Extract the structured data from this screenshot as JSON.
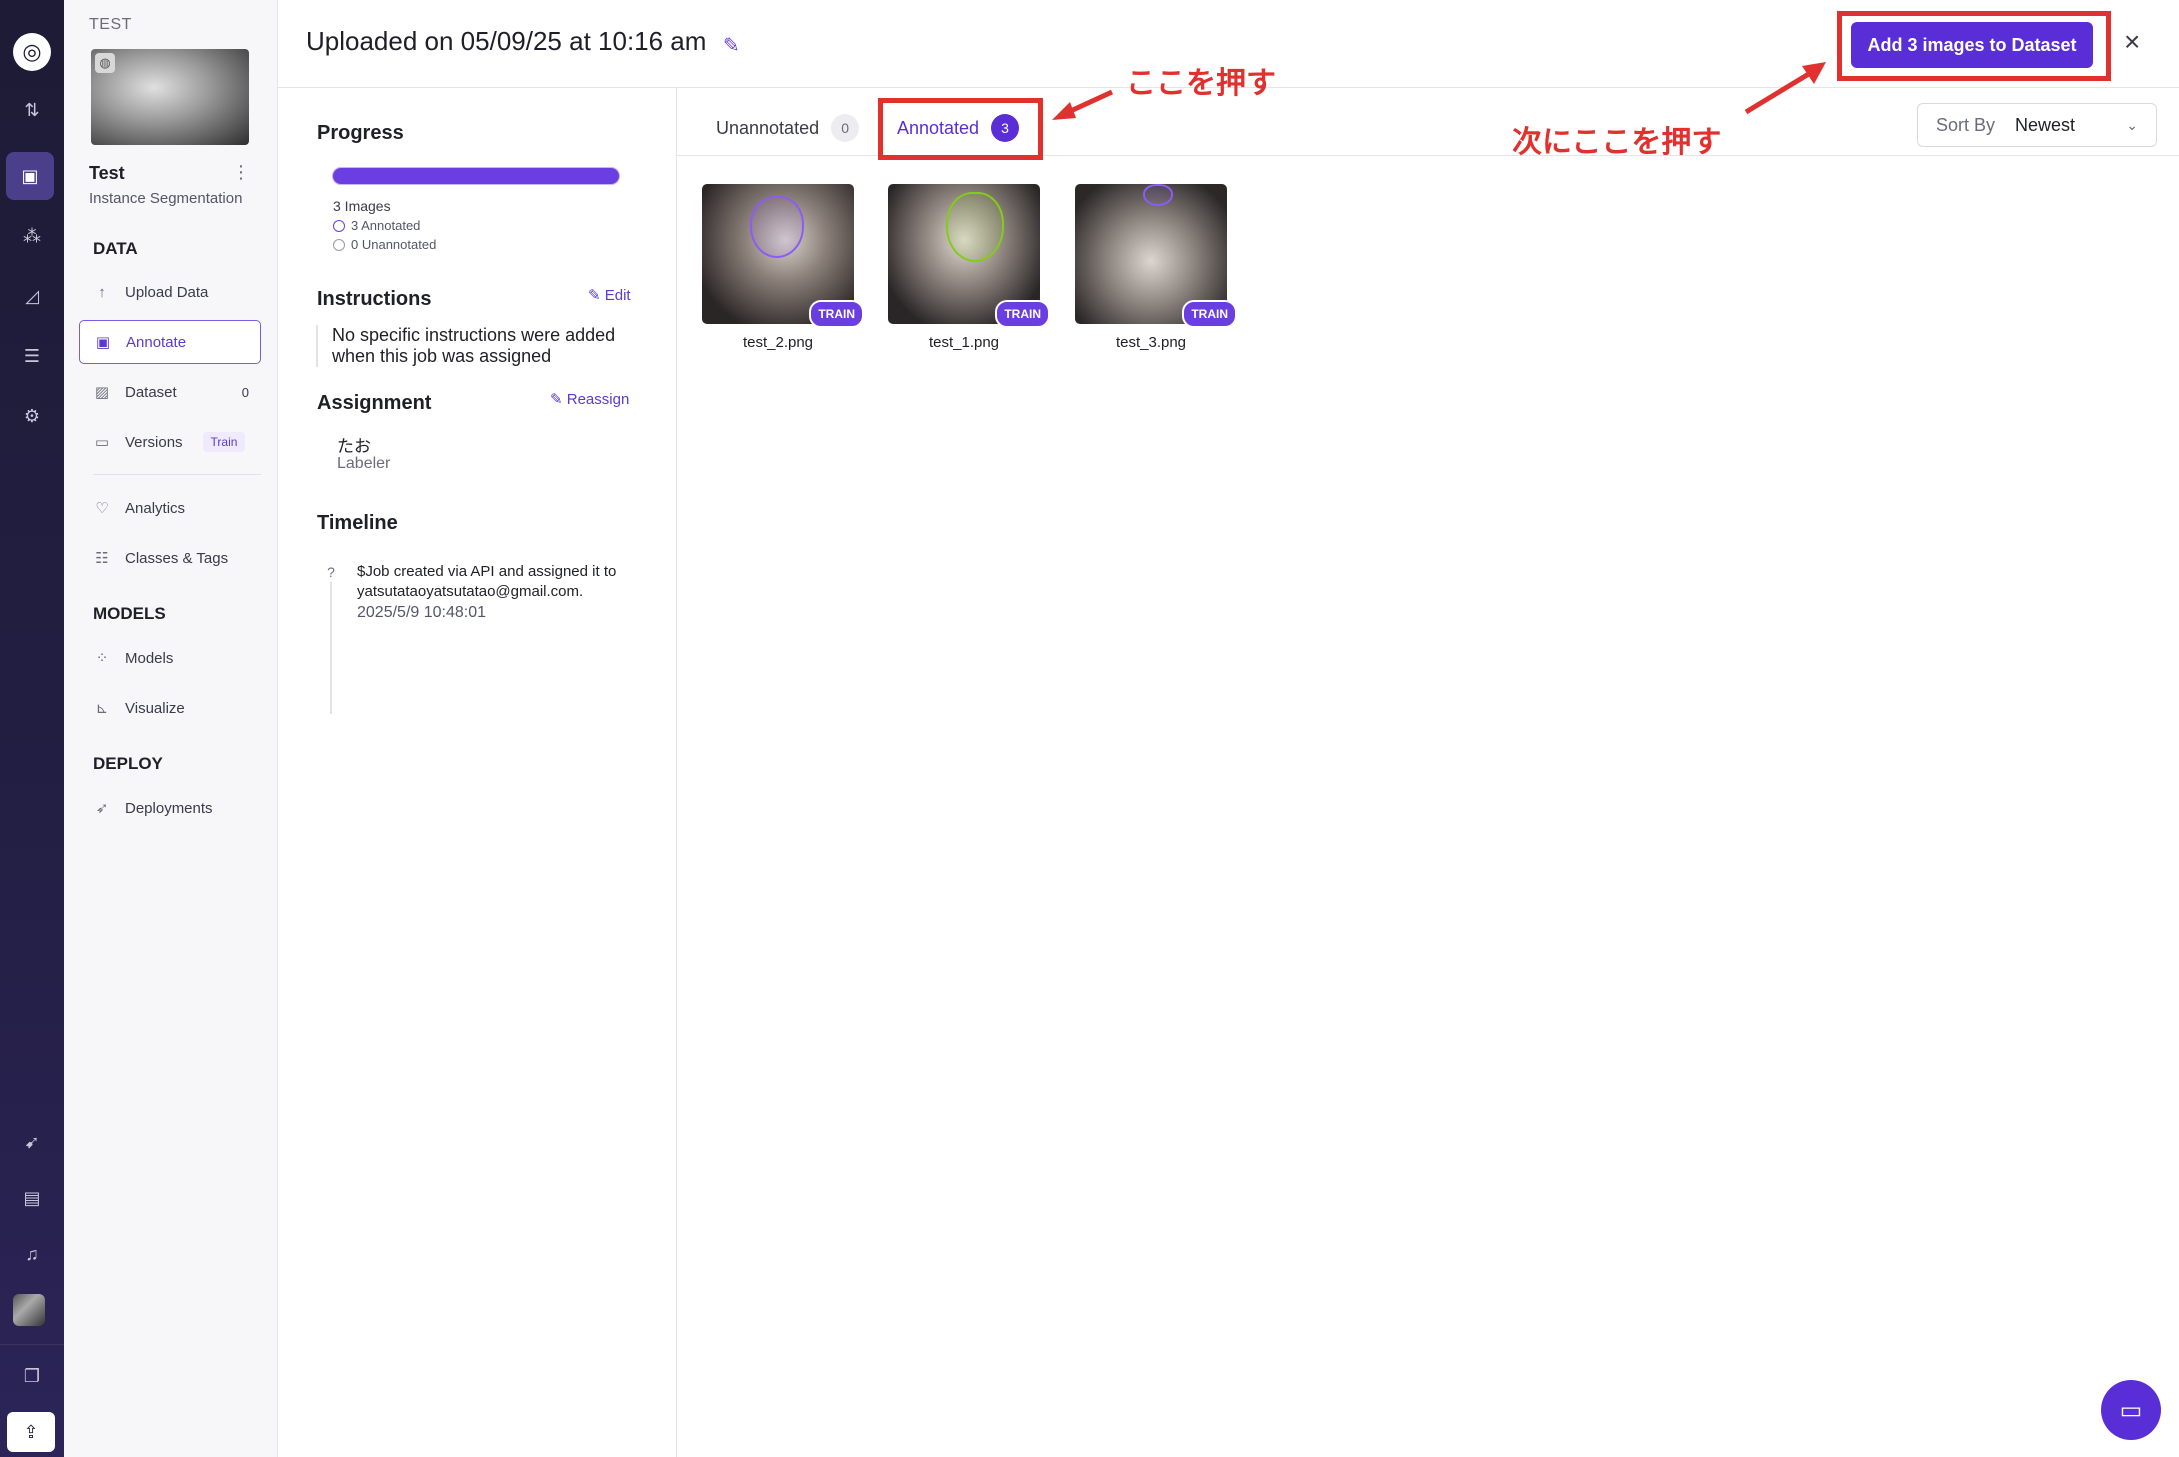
{
  "rail": {
    "icons": [
      "logo-icon",
      "swap-icon",
      "inbox-icon",
      "workflow-icon",
      "chart-icon",
      "stack-icon",
      "settings-icon",
      "rocket-icon",
      "book-icon",
      "bell-icon",
      "avatar",
      "layers-icon",
      "upload-icon"
    ]
  },
  "project": {
    "workspace": "TEST",
    "name": "Test",
    "type": "Instance Segmentation",
    "sections": {
      "data": "DATA",
      "models": "MODELS",
      "deploy": "DEPLOY"
    },
    "nav": {
      "upload": "Upload Data",
      "annotate": "Annotate",
      "dataset": "Dataset",
      "dataset_count": "0",
      "versions": "Versions",
      "versions_badge": "Train",
      "analytics": "Analytics",
      "classes": "Classes & Tags",
      "models": "Models",
      "visualize": "Visualize",
      "deployments": "Deployments"
    }
  },
  "header": {
    "title": "Uploaded on 05/09/25 at 10:16 am",
    "add_button": "Add 3 images to Dataset",
    "close": "×"
  },
  "details": {
    "progress_title": "Progress",
    "progress_fraction": 1.0,
    "images_count": "3 Images",
    "annotated": "3 Annotated",
    "unannotated": "0 Unannotated",
    "instructions_title": "Instructions",
    "instructions_edit": "Edit",
    "instructions_text": "No specific instructions were added when this job was assigned",
    "assignment_title": "Assignment",
    "reassign": "Reassign",
    "assignee": "たお",
    "assignee_role": "Labeler",
    "timeline_title": "Timeline",
    "timeline_text": "$Job created via API and assigned it to yatsutataoyatsutatao@gmail.com.",
    "timeline_time": "2025/5/9 10:48:01"
  },
  "tabs": {
    "unannotated_label": "Unannotated",
    "unannotated_count": "0",
    "annotated_label": "Annotated",
    "annotated_count": "3"
  },
  "sort": {
    "label": "Sort By",
    "value": "Newest"
  },
  "images": [
    {
      "name": "test_2.png",
      "tag": "TRAIN"
    },
    {
      "name": "test_1.png",
      "tag": "TRAIN"
    },
    {
      "name": "test_3.png",
      "tag": "TRAIN"
    }
  ],
  "annotations": {
    "first": "ここを押す",
    "second": "次にここを押す"
  },
  "colors": {
    "accent": "#5a2ed6",
    "annotation_red": "#e0312f",
    "rail_bg": "#1d1b35"
  }
}
